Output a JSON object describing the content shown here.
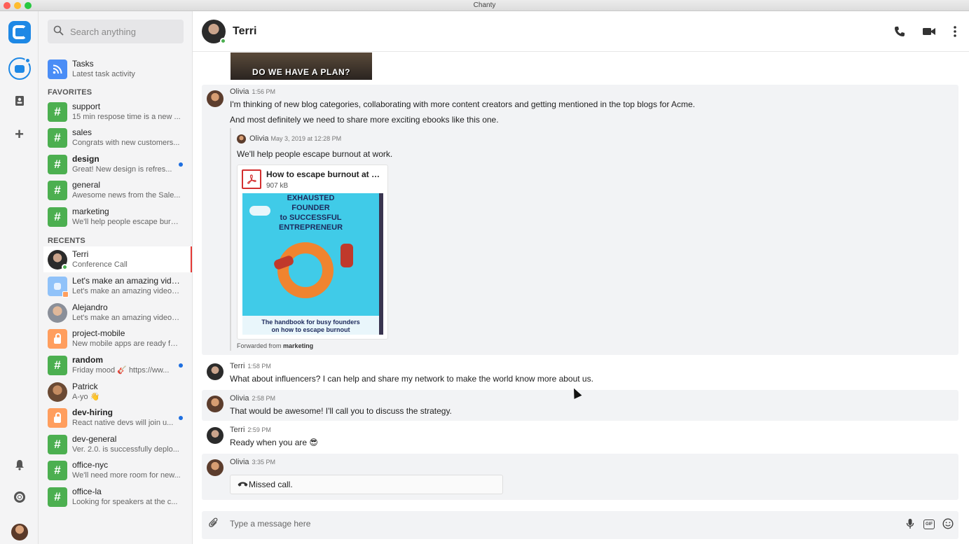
{
  "window": {
    "title": "Chanty"
  },
  "rail": {
    "logo_icon": "chanty-logo-icon",
    "items": [
      {
        "icon": "chat-icon",
        "active": true,
        "has_notification": true
      },
      {
        "icon": "contacts-book-icon"
      },
      {
        "icon": "plus-icon"
      }
    ],
    "bottom": [
      {
        "icon": "bell-icon"
      },
      {
        "icon": "help-lifebuoy-icon"
      },
      {
        "icon": "user-avatar-icon"
      }
    ]
  },
  "search": {
    "placeholder": "Search anything"
  },
  "tasks": {
    "name": "Tasks",
    "preview": "Latest task activity",
    "icon": "rss-icon"
  },
  "favorites": {
    "title": "FAVORITES",
    "items": [
      {
        "name": "support",
        "preview": "15 min respose time is a new ...",
        "icon": "hash-icon",
        "color": "#4caf50",
        "unread": false
      },
      {
        "name": "sales",
        "preview": "Congrats with new customers...",
        "icon": "hash-icon",
        "color": "#4caf50",
        "unread": false
      },
      {
        "name": "design",
        "preview": "Great! New design is refres...",
        "icon": "hash-icon",
        "color": "#4caf50",
        "unread": true
      },
      {
        "name": "general",
        "preview": "Awesome news from the Sale...",
        "icon": "hash-icon",
        "color": "#4caf50",
        "unread": false
      },
      {
        "name": "marketing",
        "preview": "We'll help people escape burn...",
        "icon": "hash-icon",
        "color": "#4caf50",
        "unread": false
      }
    ]
  },
  "recents": {
    "title": "RECENTS",
    "items": [
      {
        "name": "Terri",
        "preview": "Conference Call",
        "icon": "avatar-terri",
        "active": true,
        "online": true
      },
      {
        "name": "Let's make an amazing vide...",
        "preview": "Let's make an amazing video t...",
        "icon": "group-chat-icon"
      },
      {
        "name": "Alejandro",
        "preview": "Let's make an amazing video t...",
        "icon": "avatar-alejandro"
      },
      {
        "name": "project-mobile",
        "preview": "New mobile apps are ready fo...",
        "icon": "lock-icon",
        "color": "#ff9e5e"
      },
      {
        "name": "random",
        "preview": "Friday mood 🎸 https://ww...",
        "icon": "hash-icon",
        "color": "#4caf50",
        "unread": true
      },
      {
        "name": "Patrick",
        "preview": "A-yo 👋",
        "icon": "avatar-patrick"
      },
      {
        "name": "dev-hiring",
        "preview": "React native devs will join u...",
        "icon": "lock-icon",
        "color": "#ff9e5e",
        "unread": true
      },
      {
        "name": "dev-general",
        "preview": "Ver. 2.0. is successfully deplo...",
        "icon": "hash-icon",
        "color": "#4caf50"
      },
      {
        "name": "office-nyc",
        "preview": "We'll need more room for new...",
        "icon": "hash-icon",
        "color": "#4caf50"
      },
      {
        "name": "office-la",
        "preview": "Looking for speakers at the c...",
        "icon": "hash-icon",
        "color": "#4caf50"
      }
    ]
  },
  "conversation": {
    "name": "Terri",
    "online": true,
    "actions": [
      "phone-icon",
      "video-camera-icon",
      "more-vertical-icon"
    ],
    "gif_caption": "DO WE HAVE A PLAN?",
    "messages": [
      {
        "author": "Olivia",
        "time": "1:56 PM",
        "lines": [
          "I'm thinking of new blog categories, collaborating with more content creators and getting mentioned in the top blogs for Acme.",
          "And most definitely we need to share more exciting ebooks like this one."
        ],
        "forwarded": {
          "author": "Olivia",
          "time": "May 3, 2019 at 12:28 PM",
          "text": "We'll help people escape burnout at work.",
          "file": {
            "name": "How to escape burnout at w...",
            "size": "907 kB",
            "thumb_title": [
              "EXHAUSTED",
              "FOUNDER",
              "to SUCCESSFUL",
              "ENTREPRENEUR"
            ],
            "thumb_caption": [
              "The handbook for busy founders",
              "on how to escape burnout"
            ]
          },
          "footer_prefix": "Forwarded from",
          "footer_channel": "marketing"
        }
      },
      {
        "author": "Terri",
        "time": "1:58 PM",
        "text": "What about influencers? I can help and share my network to make the world know more about us."
      },
      {
        "author": "Olivia",
        "time": "2:58 PM",
        "text": "That would be awesome! I'll call you to discuss the strategy."
      },
      {
        "author": "Terri",
        "time": "2:59 PM",
        "text": "Ready when you are 😎"
      },
      {
        "author": "Olivia",
        "time": "3:35 PM",
        "missed_call": "Missed call."
      }
    ]
  },
  "composer": {
    "placeholder": "Type a message here",
    "icons": [
      "paperclip-icon",
      "microphone-icon",
      "gif-icon",
      "emoji-icon"
    ],
    "gif_label": "GIF"
  }
}
